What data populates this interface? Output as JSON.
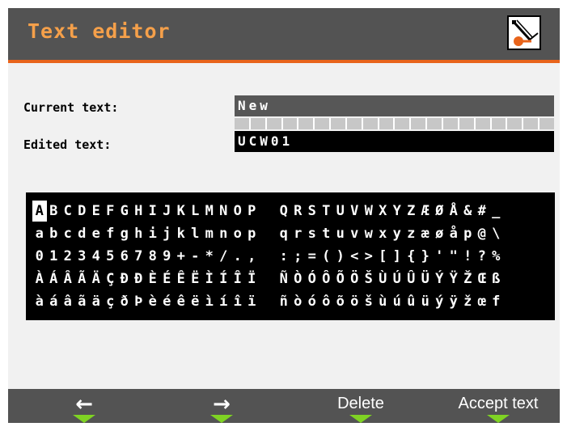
{
  "title": "Text editor",
  "fields": {
    "current_label": "Current text:",
    "current_value": "New",
    "edited_label": "Edited text:",
    "edited_value": "UCW01"
  },
  "charset": {
    "rows": [
      [
        "ABCDEFGHIJKLMNOP",
        "QRSTUVWXYZÆØÅ&#_"
      ],
      [
        "abcdefghijklmnop",
        "qrstuvwxyzæøåp@\\"
      ],
      [
        "0123456789+-*/.,",
        ":;=()<>[]{}'\"!?%"
      ],
      [
        "ÀÁÂÃÄÇÐÐÈÉÊËÌÍÎÏ",
        "ÑÒÓÔÕÖŠÙÚÛÜÝŸŽŒß"
      ],
      [
        "àáâãäçðÞèéêëìíîï",
        "ñòóôõöšùúûüýÿžœf"
      ]
    ],
    "selected": "A"
  },
  "softkeys": {
    "left_icon": "left-arrow-icon",
    "left_glyph": "←",
    "right_icon": "right-arrow-icon",
    "right_glyph": "→",
    "delete": "Delete",
    "accept": "Accept text"
  },
  "colors": {
    "title": "#f5a04a",
    "accent_line": "#e8641b",
    "softkey_indicator": "#7fd323",
    "bar": "#535353"
  }
}
